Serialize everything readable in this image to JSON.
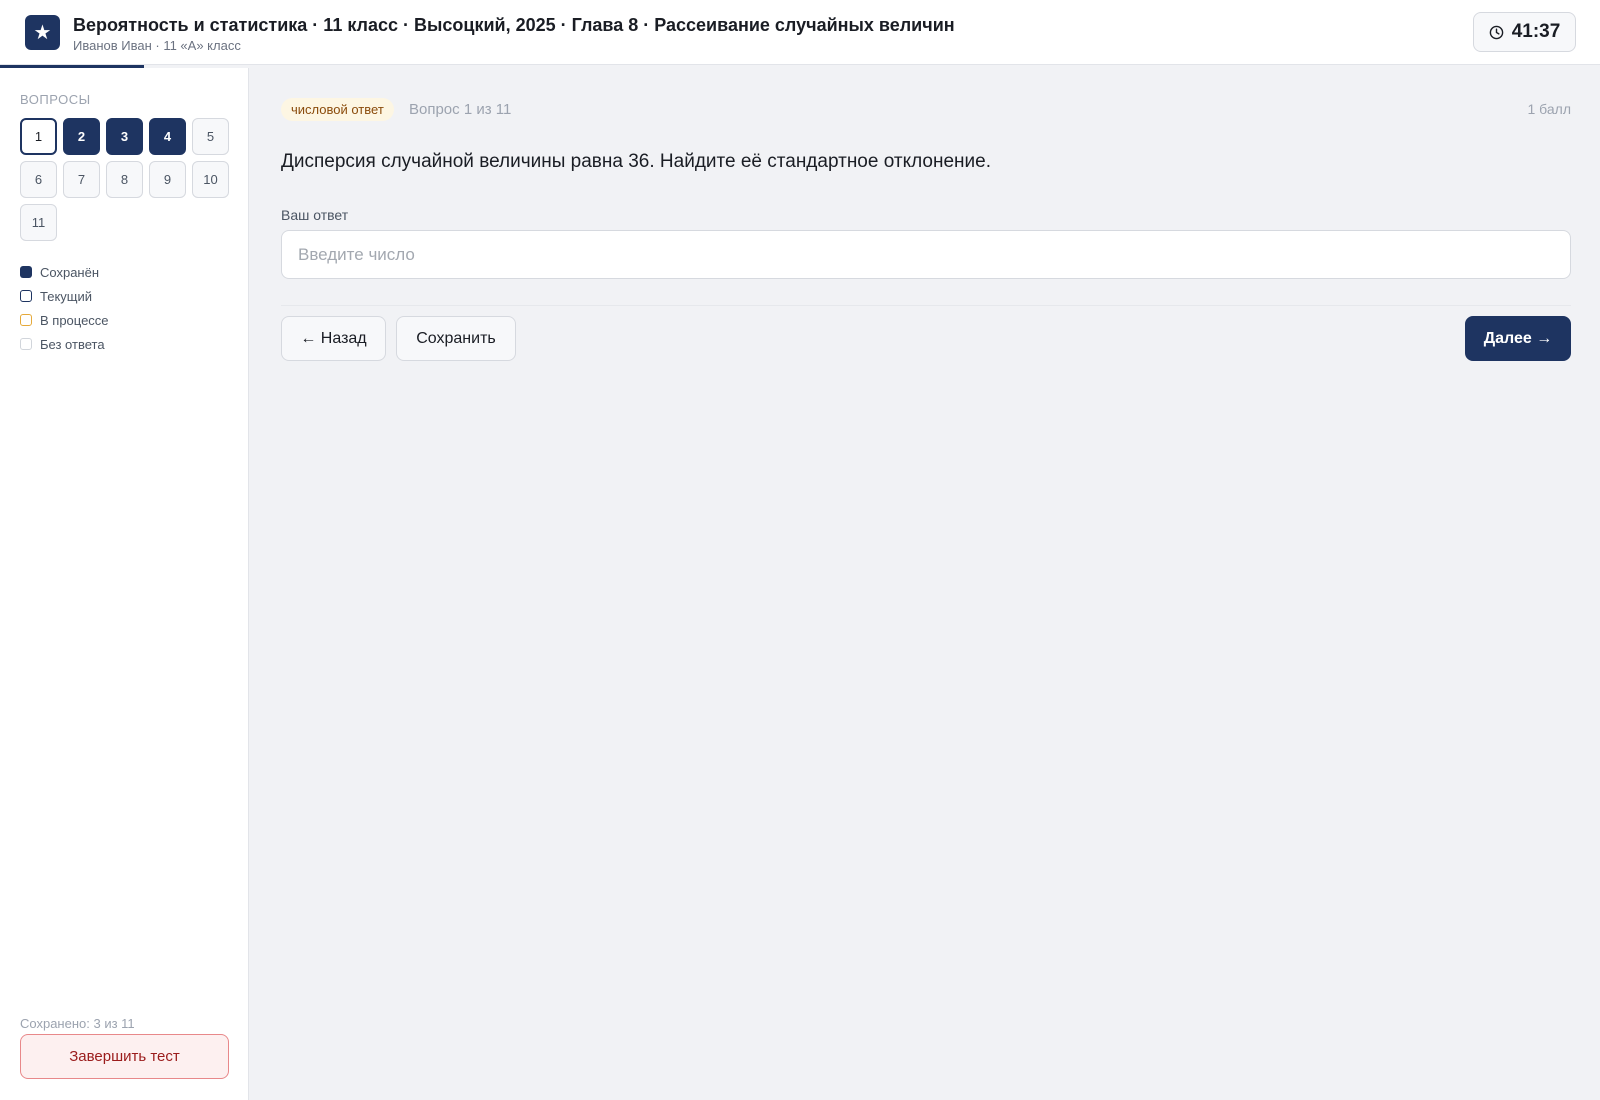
{
  "header": {
    "logo_glyph": "★",
    "title": "Вероятность и статистика · 11 класс · Высоцкий, 2025 · Глава 8 · Рассеивание случайных величин",
    "subtitle": "Иванов Иван · 11 «А» класс",
    "timer": "41:37"
  },
  "sidebar": {
    "heading": "ВОПРОСЫ",
    "questions": [
      {
        "label": "1",
        "status": "current"
      },
      {
        "label": "2",
        "status": "saved"
      },
      {
        "label": "3",
        "status": "saved"
      },
      {
        "label": "4",
        "status": "saved"
      },
      {
        "label": "5",
        "status": "empty"
      },
      {
        "label": "6",
        "status": "empty"
      },
      {
        "label": "7",
        "status": "empty"
      },
      {
        "label": "8",
        "status": "empty"
      },
      {
        "label": "9",
        "status": "empty"
      },
      {
        "label": "10",
        "status": "empty"
      },
      {
        "label": "11",
        "status": "empty"
      }
    ],
    "legend": {
      "saved": "Сохранён",
      "current": "Текущий",
      "in_progress": "В процессе",
      "no_answer": "Без ответа"
    },
    "saved_count": "Сохранено: 3 из 11",
    "finish_label": "Завершить тест"
  },
  "main": {
    "badge": "числовой ответ",
    "question_number": "Вопрос 1 из 11",
    "points": "1 балл",
    "question_text": "Дисперсия случайной величины равна 36. Найдите её стандартное отклонение.",
    "answer_label": "Ваш ответ",
    "answer_placeholder": "Введите число",
    "answer_value": "",
    "back_label": "← Назад",
    "save_label": "Сохранить",
    "next_label": "Далее →"
  },
  "colors": {
    "primary": "#1e3461",
    "in_progress": "#e5a93a",
    "danger": "#9b1c1c",
    "badge_bg": "#fdf6e3"
  },
  "icons": {
    "logo": "star-icon",
    "timer": "clock-icon"
  }
}
